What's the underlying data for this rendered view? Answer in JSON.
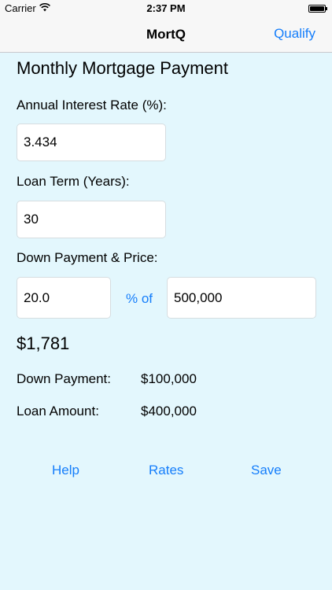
{
  "status": {
    "carrier": "Carrier",
    "time": "2:37 PM"
  },
  "nav": {
    "title": "MortQ",
    "right_button": "Qualify"
  },
  "main": {
    "section_title": "Monthly Mortgage Payment",
    "interest_label": "Annual Interest Rate (%):",
    "interest_value": "3.434",
    "term_label": "Loan Term (Years):",
    "term_value": "30",
    "down_price_label": "Down Payment & Price:",
    "down_percent_value": "20.0",
    "percent_of_label": "% of",
    "price_value": "500,000",
    "monthly_payment": "$1,781",
    "down_payment_label": "Down Payment:",
    "down_payment_value": "$100,000",
    "loan_amount_label": "Loan Amount:",
    "loan_amount_value": "$400,000"
  },
  "footer": {
    "help": "Help",
    "rates": "Rates",
    "save": "Save"
  },
  "colors": {
    "accent": "#157efb",
    "background": "#e3f7fd"
  }
}
